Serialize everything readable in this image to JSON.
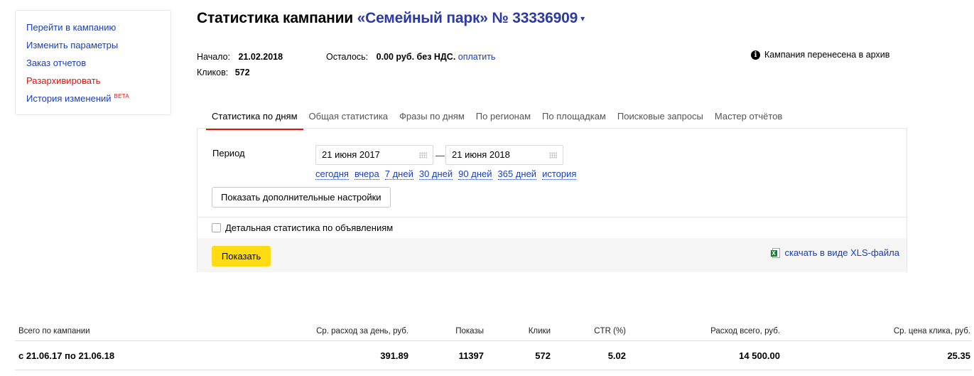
{
  "sidebar": {
    "items": [
      {
        "label": "Перейти в кампанию"
      },
      {
        "label": "Изменить параметры"
      },
      {
        "label": "Заказ отчетов"
      },
      {
        "label": "Разархивировать"
      },
      {
        "label": "История изменений",
        "badge": "BETA"
      }
    ]
  },
  "header": {
    "title_prefix": "Статистика кампании",
    "campaign_name": "«Семейный парк» № 33336909",
    "caret": "▾"
  },
  "info": {
    "start_label": "Начало:",
    "start_value": "21.02.2018",
    "clicks_label": "Кликов:",
    "clicks_value": "572",
    "remaining_label": "Осталось:",
    "remaining_value": "0.00 руб. без НДС.",
    "pay_link": "оплатить",
    "archive_notice": "Кампания перенесена в архив"
  },
  "tabs": [
    {
      "label": "Статистика по дням",
      "active": true
    },
    {
      "label": "Общая статистика"
    },
    {
      "label": "Фразы по дням"
    },
    {
      "label": "По регионам"
    },
    {
      "label": "По площадкам"
    },
    {
      "label": "Поисковые запросы"
    },
    {
      "label": "Мастер отчётов"
    }
  ],
  "filters": {
    "period_label": "Период",
    "date_from": "21 июня 2017",
    "date_to": "21 июня 2018",
    "dash": "—",
    "quick": [
      "сегодня",
      "вчера",
      "7 дней",
      "30 дней",
      "90 дней",
      "365 дней",
      "история"
    ],
    "more_settings": "Показать дополнительные настройки",
    "detailed_label": "Детальная статистика по объявлениям",
    "show_button": "Показать",
    "xls_link": "скачать в виде XLS-файла"
  },
  "summary": {
    "headers": [
      "Всего по кампании",
      "Ср. расход за день, руб.",
      "Показы",
      "Клики",
      "CTR (%)",
      "Расход всего, руб.",
      "Ср. цена клика, руб."
    ],
    "row": [
      "с 21.06.17 по 21.06.18",
      "391.89",
      "11397",
      "572",
      "5.02",
      "14 500.00",
      "25.35"
    ]
  },
  "colors": {
    "link": "#1a3dc1",
    "accent_red": "#e3120b",
    "button_yellow": "#ffdb14"
  }
}
